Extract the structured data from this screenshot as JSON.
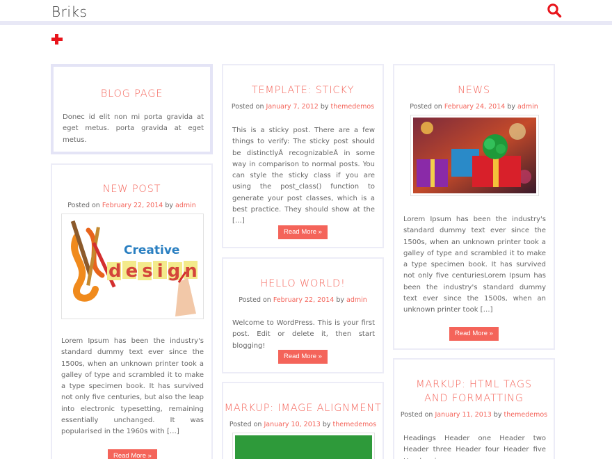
{
  "header": {
    "site_title": "Briks",
    "search_icon": "search-icon",
    "menu_icon": "plus-icon",
    "accent": "#f4645a"
  },
  "posts": {
    "blog": {
      "title": "BLOG PAGE",
      "excerpt": "Donec id elit non mi porta gravida at eget metus. porta gravida at eget metus."
    },
    "newpost": {
      "title": "NEW POST",
      "posted": "Posted on",
      "date": "February 22, 2014",
      "by": "by",
      "author": "admin",
      "image_word1": "Creative",
      "image_word2": "design",
      "excerpt": "Lorem Ipsum has been the industry's standard dummy text ever since the 1500s, when an unknown printer took a galley of type and scrambled it to make a type specimen book. It has survived not only five centuries, but also the leap into electronic typesetting, remaining essentially unchanged. It was popularised in the 1960s with […]",
      "more": "Read More »"
    },
    "sticky": {
      "title": "TEMPLATE: STICKY",
      "posted": "Posted on",
      "date": "January 7, 2012",
      "by": "by",
      "author": "themedemos",
      "excerpt": "This is a sticky post. There are a few things to verify: The sticky post should be distinctlyÂ recognizableÂ in some way in comparison to normal posts. You can style the sticky class if you are using the post_class() function to generate your post classes, which is a best practice. They should show at the […]",
      "more": "Read More »"
    },
    "hello": {
      "title": "HELLO WORLD!",
      "posted": "Posted on",
      "date": "February 22, 2014",
      "by": "by",
      "author": "admin",
      "excerpt": "Welcome to WordPress. This is your first post. Edit or delete it, then start blogging!",
      "more": "Read More »"
    },
    "image_align": {
      "title": "MARKUP: IMAGE ALIGNMENT",
      "posted": "Posted on",
      "date": "January 10, 2013",
      "by": "by",
      "author": "themedemos"
    },
    "news": {
      "title": "NEWS",
      "posted": "Posted on",
      "date": "February 24, 2014",
      "by": "by",
      "author": "admin",
      "excerpt": "Lorem Ipsum has been the industry's standard dummy text ever since the 1500s, when an unknown printer took a galley of type and scrambled it to make a type specimen book. It has survived not only five centuriesLorem Ipsum has been the industry's standard dummy text ever since the 1500s, when an unknown printer took […]",
      "more": "Read More »"
    },
    "html_tags": {
      "title": "MARKUP: HTML TAGS AND FORMATTING",
      "posted": "Posted on",
      "date": "January 11, 2013",
      "by": "by",
      "author": "themedemos",
      "excerpt": "Headings Header one Header two Header three Header four Header five Header six"
    }
  }
}
